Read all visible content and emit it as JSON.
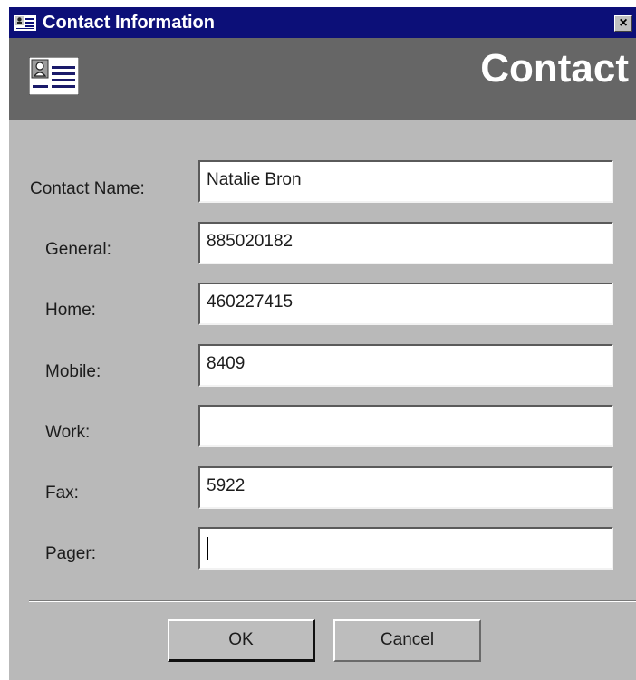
{
  "window": {
    "title": "Contact Information",
    "close_symbol": "×"
  },
  "header": {
    "title": "Contact",
    "icon": "contact-card-icon"
  },
  "fields": [
    {
      "label": "Contact Name:",
      "value": "Natalie Bron"
    },
    {
      "label": "General:",
      "value": "885020182"
    },
    {
      "label": "Home:",
      "value": "460227415"
    },
    {
      "label": "Mobile:",
      "value": "8409"
    },
    {
      "label": "Work:",
      "value": ""
    },
    {
      "label": "Fax:",
      "value": "5922"
    },
    {
      "label": "Pager:",
      "value": ""
    }
  ],
  "buttons": {
    "ok": "OK",
    "cancel": "Cancel"
  },
  "colors": {
    "titlebar": "#0c0f78",
    "header": "#666666",
    "dialog_background": "#b9b9b9"
  }
}
